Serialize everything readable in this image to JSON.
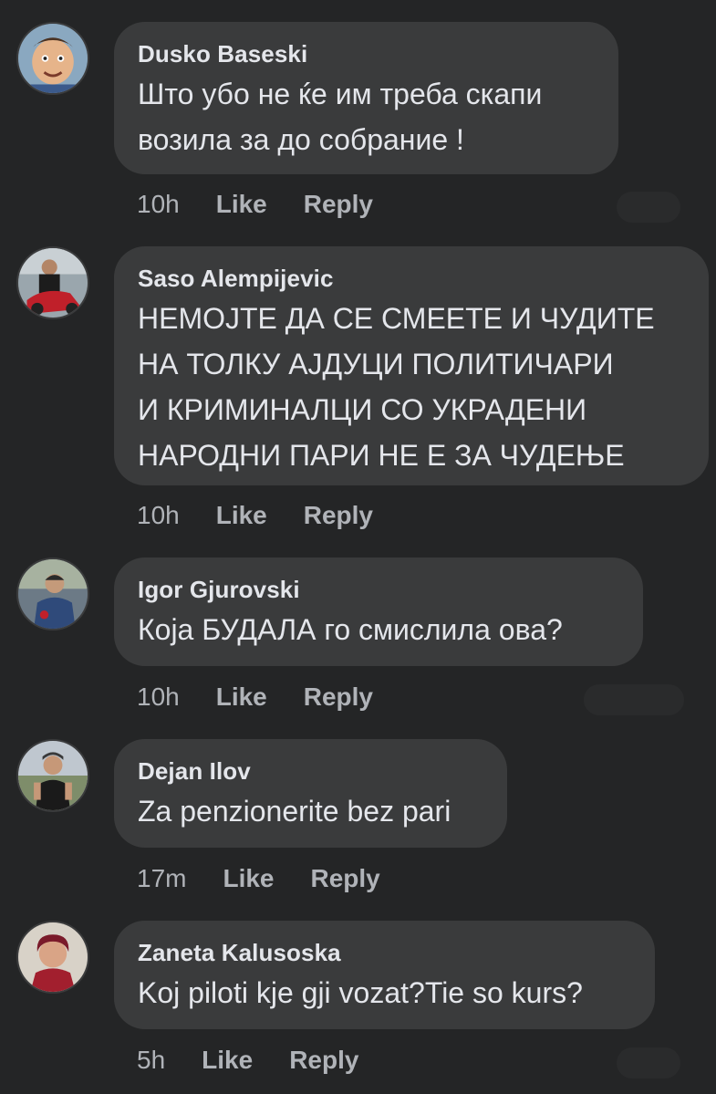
{
  "comments": [
    {
      "author": "Dusko Baseski",
      "text": "Што убо не ќе им треба скапи\nвозила за до собрание !",
      "time": "10h",
      "like": "Like",
      "reply": "Reply"
    },
    {
      "author": "Saso Alempijevic",
      "text": "НЕМОЈТЕ ДА СЕ СМЕЕТЕ И ЧУДИТЕ\nНА ТОЛКУ АЈДУЦИ ПОЛИТИЧАРИ\nИ КРИМИНАЛЦИ СО УКРАДЕНИ\nНАРОДНИ ПАРИ НЕ Е ЗА ЧУДЕЊЕ",
      "time": "10h",
      "like": "Like",
      "reply": "Reply"
    },
    {
      "author": "Igor Gjurovski",
      "text": "Која БУДАЛА го смислила ова?",
      "time": "10h",
      "like": "Like",
      "reply": "Reply"
    },
    {
      "author": "Dejan Ilov",
      "text": "Za penzionerite bez pari",
      "time": "17m",
      "like": "Like",
      "reply": "Reply"
    },
    {
      "author": "Zaneta Kalusoska",
      "text": "Koj piloti kje gji vozat?Tie so kurs?",
      "time": "5h",
      "like": "Like",
      "reply": "Reply"
    }
  ],
  "colors": {
    "background": "#242526",
    "bubble": "#3a3b3c",
    "primary_text": "#e4e6eb",
    "secondary_text": "#b0b3b8"
  }
}
